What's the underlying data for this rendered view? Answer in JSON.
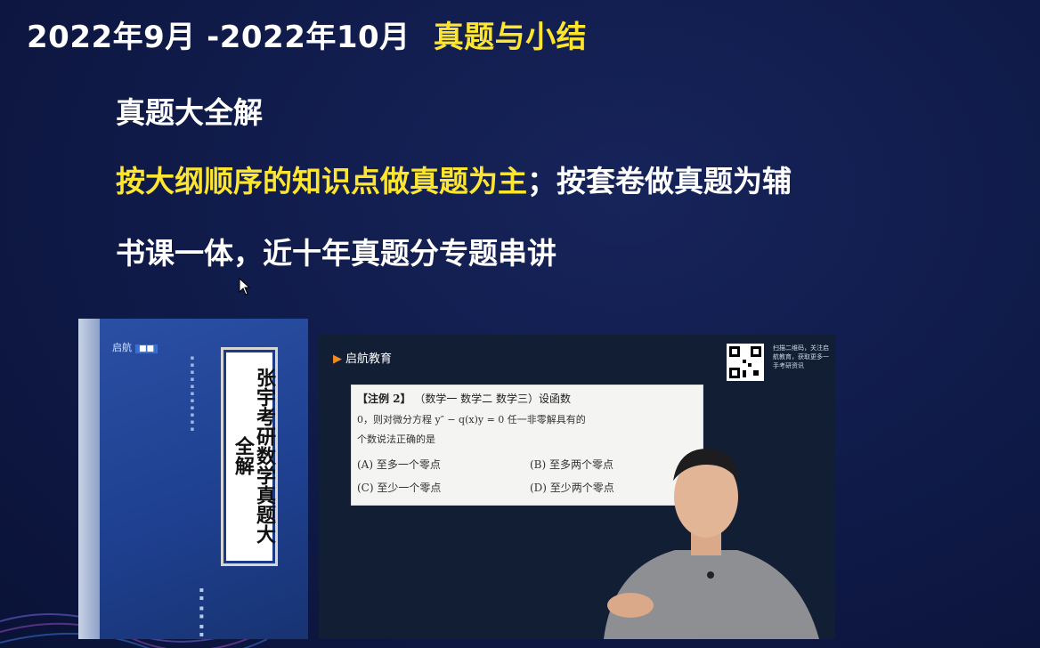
{
  "header": {
    "date_range": "2022年9月 -2022年10月",
    "section": "真题与小结"
  },
  "bullets": {
    "line1": "真题大全解",
    "line2_highlight": "按大纲顺序的知识点做真题为主",
    "line2_rest": "；按套卷做真题为辅",
    "line3": "书课一体，近十年真题分专题串讲"
  },
  "book": {
    "publisher_logo": "启航",
    "title": "张宇考研数学真题大全解"
  },
  "video": {
    "brand": "启航教育",
    "qr_caption": "扫描二维码，关注启航教育，获取更多一手考研资讯",
    "question_tag": "【注例 2】",
    "subjects": "（数学一    数学二    数学三）设函数",
    "question_line1": "0，则对微分方程 y″ − q(x)y = 0 任一非零解具有的",
    "question_line2": "个数说法正确的是",
    "option_a": "(A) 至多一个零点",
    "option_b": "(B) 至多两个零点",
    "option_c": "(C) 至少一个零点",
    "option_d": "(D) 至少两个零点"
  },
  "colors": {
    "background": "#0f1a48",
    "accent_yellow": "#ffe62e",
    "text_white": "#ffffff"
  }
}
